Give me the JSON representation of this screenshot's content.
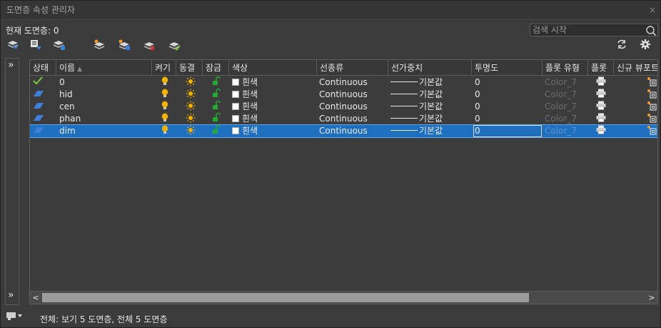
{
  "window": {
    "title": "도면층 속성 관리자",
    "close_glyph": "×"
  },
  "current_layer": "현재 도면층: 0",
  "search": {
    "placeholder": "검색 시작"
  },
  "toolbar": {
    "left_icons": [
      "new-property-filter-icon",
      "new-group-filter-icon",
      "layer-states-manager-icon",
      "new-layer-icon",
      "new-layer-vp-frozen-icon",
      "delete-layer-icon",
      "set-current-icon"
    ],
    "right_icons": [
      "refresh-icon",
      "settings-icon"
    ]
  },
  "side": {
    "expand_top": "»",
    "expand_bottom": "»"
  },
  "columns": [
    "상태",
    "이름",
    "켜기",
    "동결",
    "잠금",
    "색상",
    "선종류",
    "선가중치",
    "투명도",
    "플롯 유형",
    "플롯",
    "신규 뷰포트"
  ],
  "rows": [
    {
      "status": "current",
      "name": "0",
      "color": "흰색",
      "linetype": "Continuous",
      "lineweight": "기본값",
      "transparency": "0",
      "plot_style": "Color_7"
    },
    {
      "status": "layer",
      "name": "hid",
      "color": "흰색",
      "linetype": "Continuous",
      "lineweight": "기본값",
      "transparency": "0",
      "plot_style": "Color_7"
    },
    {
      "status": "layer",
      "name": "cen",
      "color": "흰색",
      "linetype": "Continuous",
      "lineweight": "기본값",
      "transparency": "0",
      "plot_style": "Color_7"
    },
    {
      "status": "layer",
      "name": "phan",
      "color": "흰색",
      "linetype": "Continuous",
      "lineweight": "기본값",
      "transparency": "0",
      "plot_style": "Color_7"
    },
    {
      "status": "layer",
      "name": "dim",
      "color": "흰색",
      "linetype": "Continuous",
      "lineweight": "기본값",
      "transparency": "0",
      "plot_style": "Color_7",
      "selected": true
    }
  ],
  "scrollbar": {
    "left": "<",
    "right": ">"
  },
  "status_bar": "전체: 보기 5 도면층, 전체 5 도면층",
  "colors": {
    "selection": "#1f6fbf",
    "bulb": "#f2b200",
    "sun": "#f2b200",
    "lock": "#22aa33",
    "check": "#7ac943",
    "layer_icon": "#3d7fd9"
  }
}
